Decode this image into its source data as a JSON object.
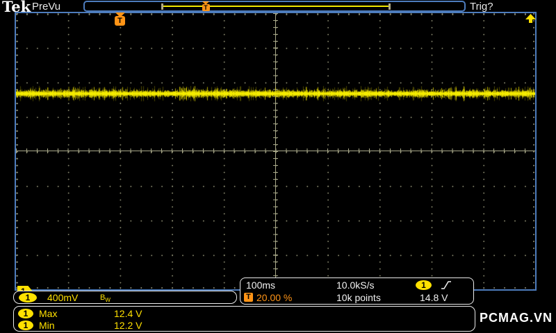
{
  "header": {
    "logo": "Tek",
    "mode": "PreVu",
    "trig_status": "Trig?"
  },
  "trigger": {
    "marker_label": "T"
  },
  "channel_ground_tag": "1",
  "readouts": {
    "channel": {
      "badge": "1",
      "scale": "400mV",
      "bw_main": "B",
      "bw_sub": "W"
    },
    "horizontal": {
      "timebase": "100ms",
      "sample_rate": "10.0kS/s",
      "record_length": "10k points"
    },
    "trigger": {
      "icon": "T",
      "position": "20.00 %",
      "source_badge": "1",
      "level": "14.8 V"
    }
  },
  "measurements": [
    {
      "badge": "1",
      "name": "Max",
      "value": "12.4 V"
    },
    {
      "badge": "1",
      "name": "Min",
      "value": "12.2 V"
    }
  ],
  "watermark": "PCMAG.VN",
  "colors": {
    "blue": "#4d7cbd",
    "chYellow": "#ffe100",
    "traceYellow": "#f2e800",
    "orange": "#ff9416",
    "gridDot": "#7c7c64",
    "gridLine": "#a8a889",
    "gridTick": "#90907a",
    "white": "#f2f2f2"
  }
}
